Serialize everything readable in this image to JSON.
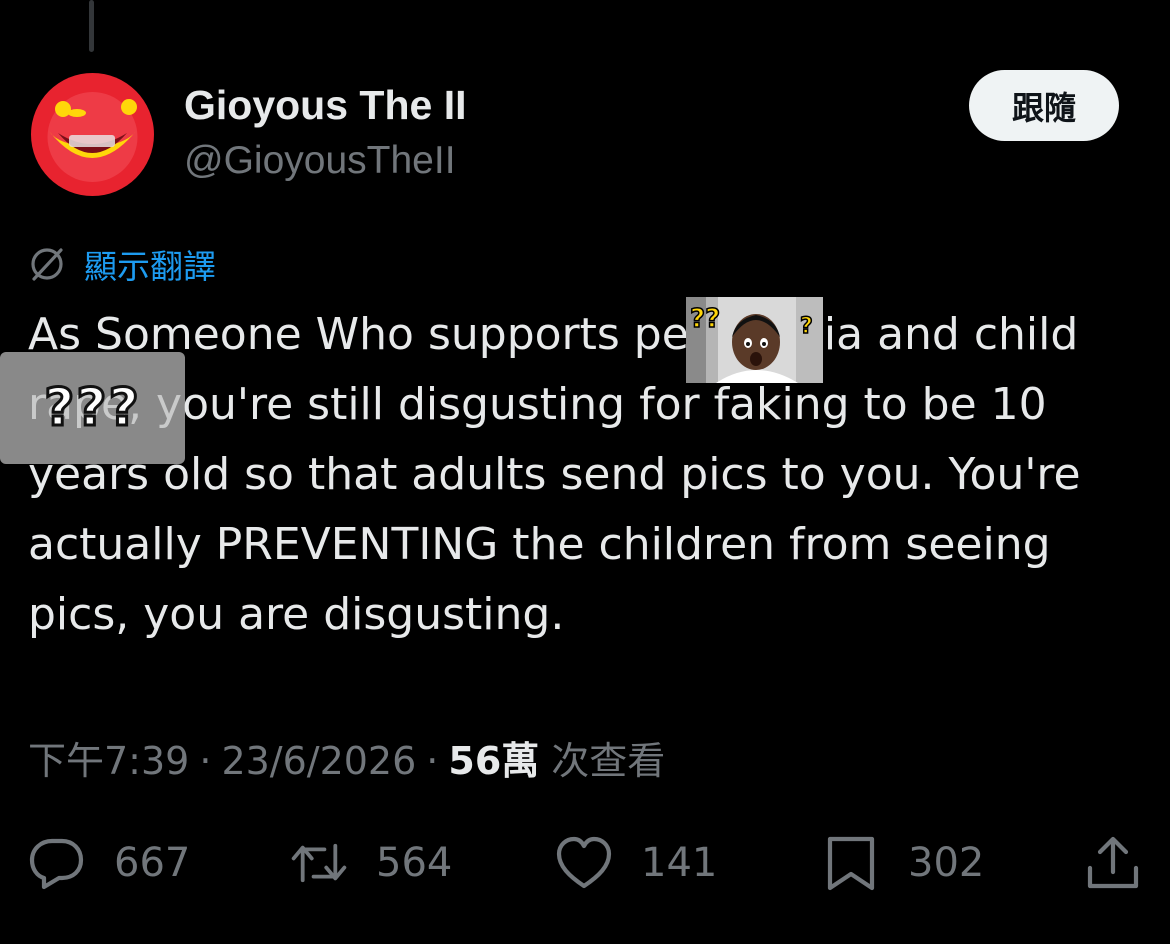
{
  "user": {
    "display_name": "Gioyous The II",
    "handle": "@GioyousTheII",
    "avatar_icon": "red-emoji-face-avatar"
  },
  "follow_button": {
    "label": "跟隨"
  },
  "translate": {
    "icon": "globe-slash-icon",
    "label": "顯示翻譯"
  },
  "tweet": {
    "text": "As Someone Who supports pedophilia and child\nrape, you're still disgusting for faking to be 10\nyears old so that adults send pics to you. You're\nactually PREVENTING the children from seeing\npics, you are disgusting."
  },
  "stickers": {
    "left_text": "???",
    "meme_marks": [
      "??",
      "?"
    ]
  },
  "meta": {
    "time": "下午7:39",
    "date": "23/6/2026",
    "views_count": "56萬",
    "views_label": "次查看",
    "separator": "·"
  },
  "actions": {
    "reply": {
      "icon": "reply-icon",
      "count": "667"
    },
    "retweet": {
      "icon": "retweet-icon",
      "count": "564"
    },
    "like": {
      "icon": "heart-icon",
      "count": "141"
    },
    "bookmark": {
      "icon": "bookmark-icon",
      "count": "302"
    },
    "share": {
      "icon": "share-icon"
    }
  },
  "colors": {
    "background": "#000000",
    "primary_text": "#e7e9ea",
    "secondary_text": "#71767b",
    "link_blue": "#1d9bf0",
    "follow_bg": "#eff3f4",
    "avatar_red": "#e8232f"
  }
}
